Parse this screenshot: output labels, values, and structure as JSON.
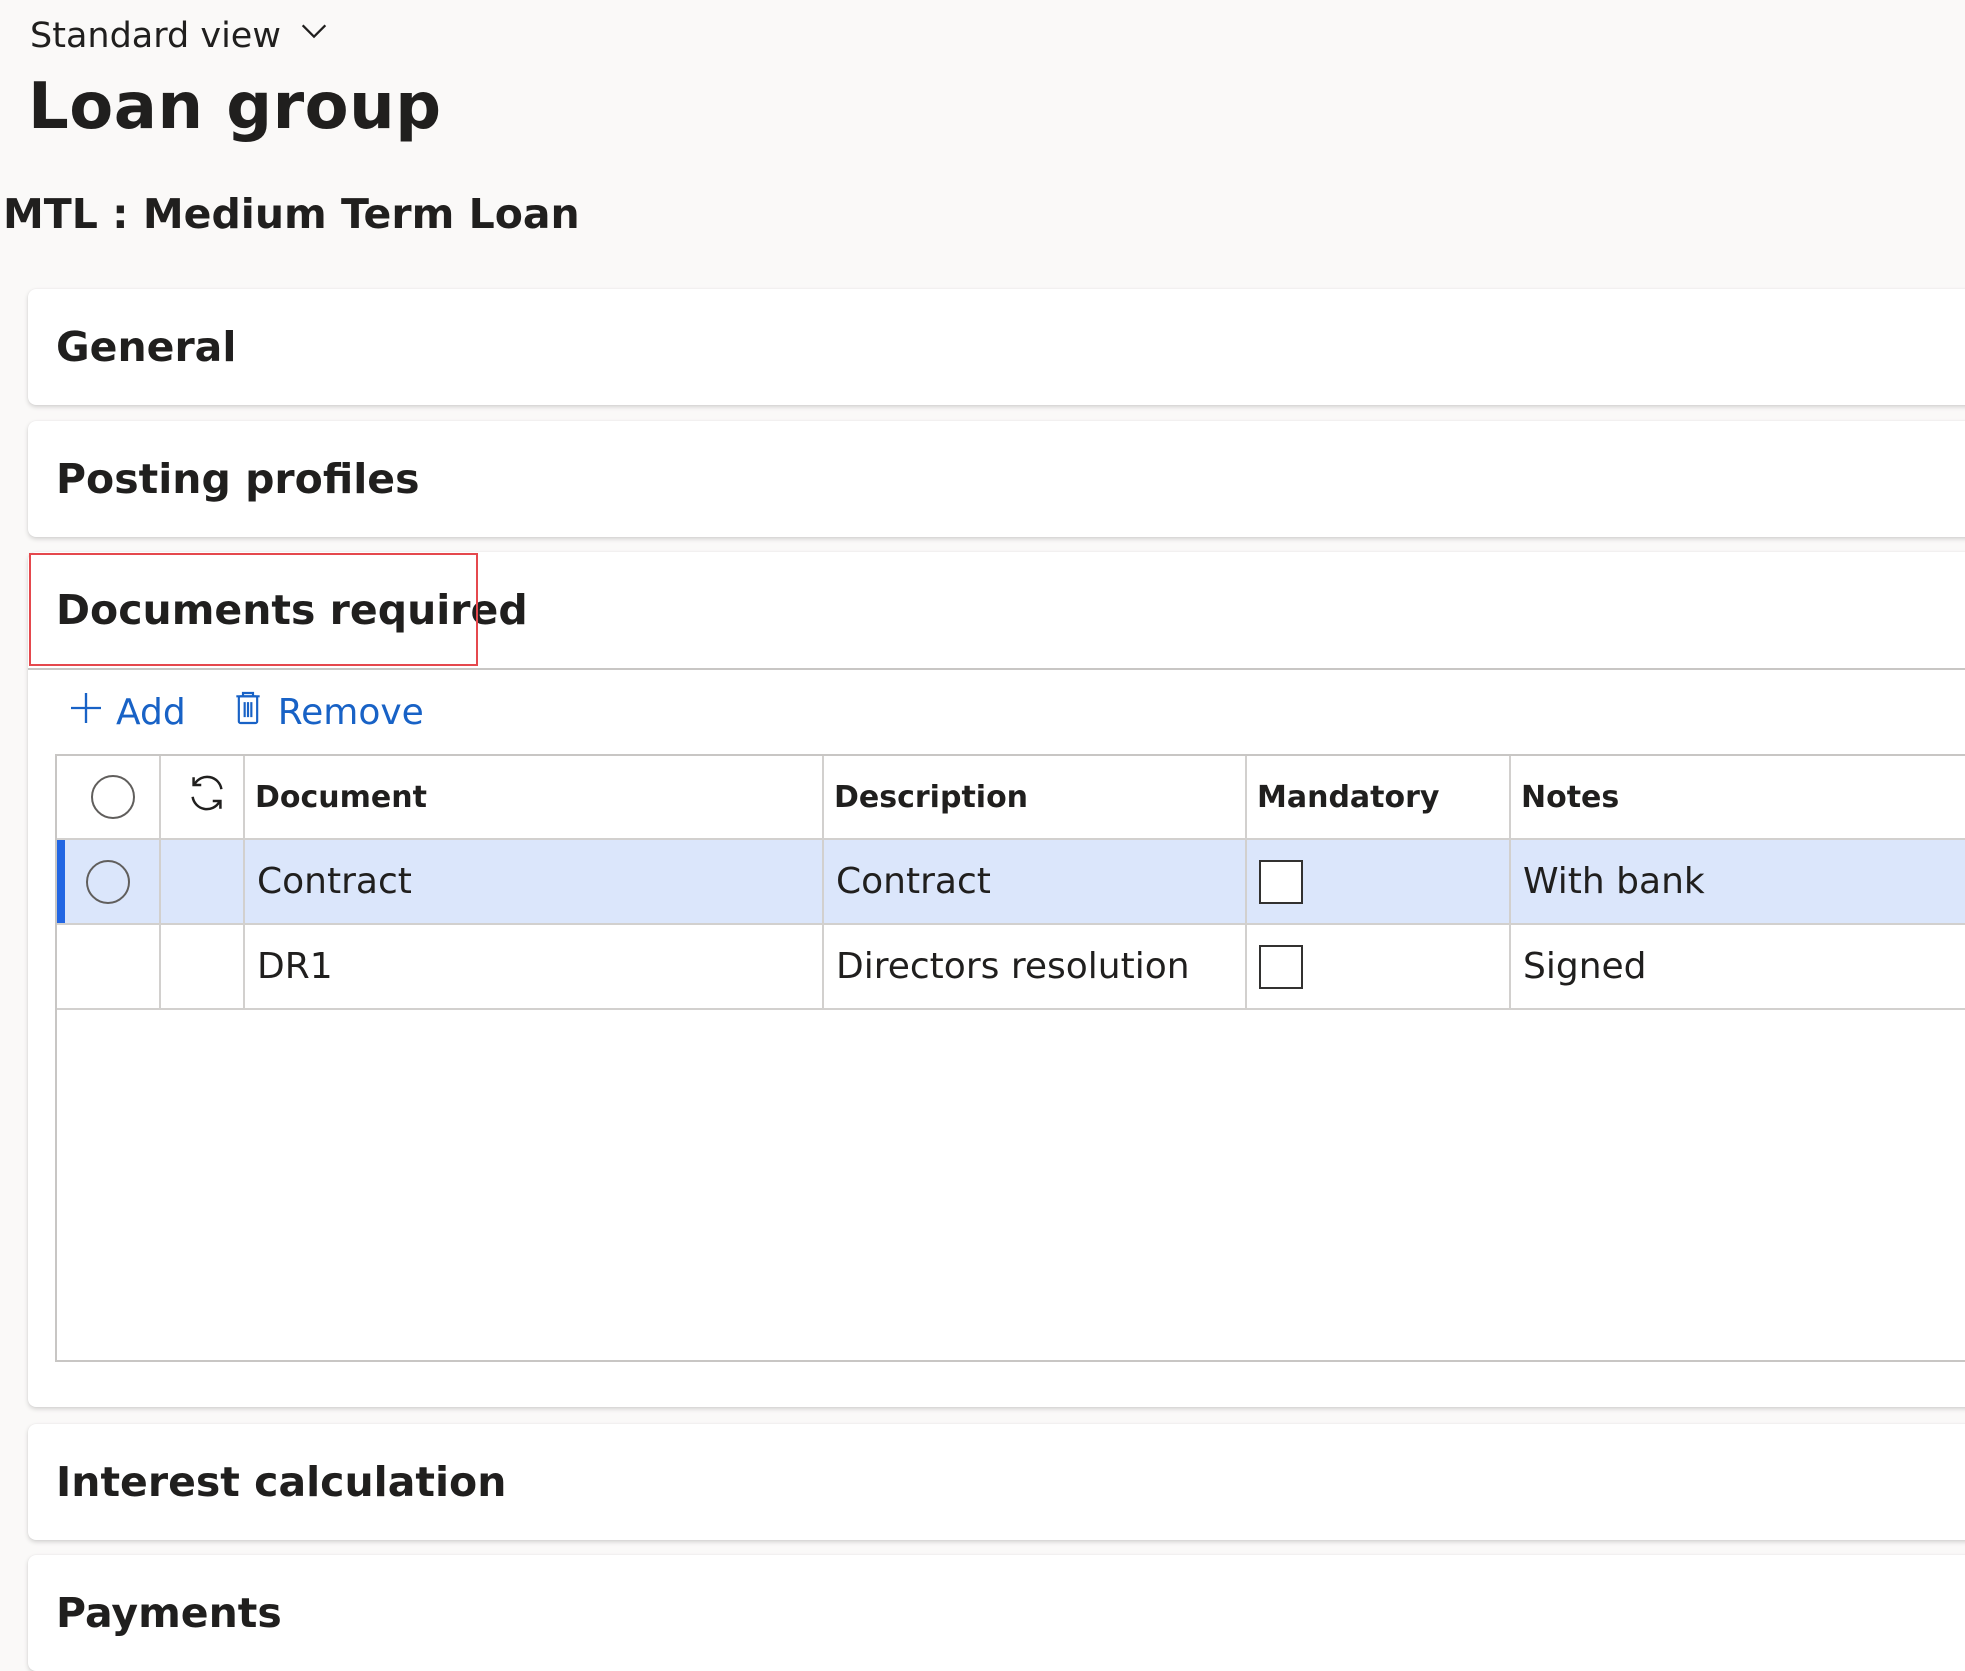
{
  "view_selector": {
    "label": "Standard view",
    "icon": "chevron-down-icon"
  },
  "page_title": "Loan group",
  "record_title": "MTL : Medium Term Loan",
  "sections": {
    "general": "General",
    "posting_profiles": "Posting profiles",
    "documents_required": "Documents required",
    "interest_calculation": "Interest calculation",
    "payments": "Payments"
  },
  "toolbar": {
    "add_label": "Add",
    "remove_label": "Remove"
  },
  "grid": {
    "columns": [
      "Document",
      "Description",
      "Mandatory",
      "Notes"
    ],
    "rows": [
      {
        "document": "Contract",
        "description": "Contract",
        "mandatory": false,
        "notes": "With bank",
        "selected": true
      },
      {
        "document": "DR1",
        "description": "Directors resolution",
        "mandatory": false,
        "notes": "Signed",
        "selected": false
      }
    ]
  },
  "colors": {
    "accent": "#1862c6",
    "selected_row": "#dbe6fb",
    "selected_bar": "#2266e3",
    "highlight": "#e5484d"
  }
}
